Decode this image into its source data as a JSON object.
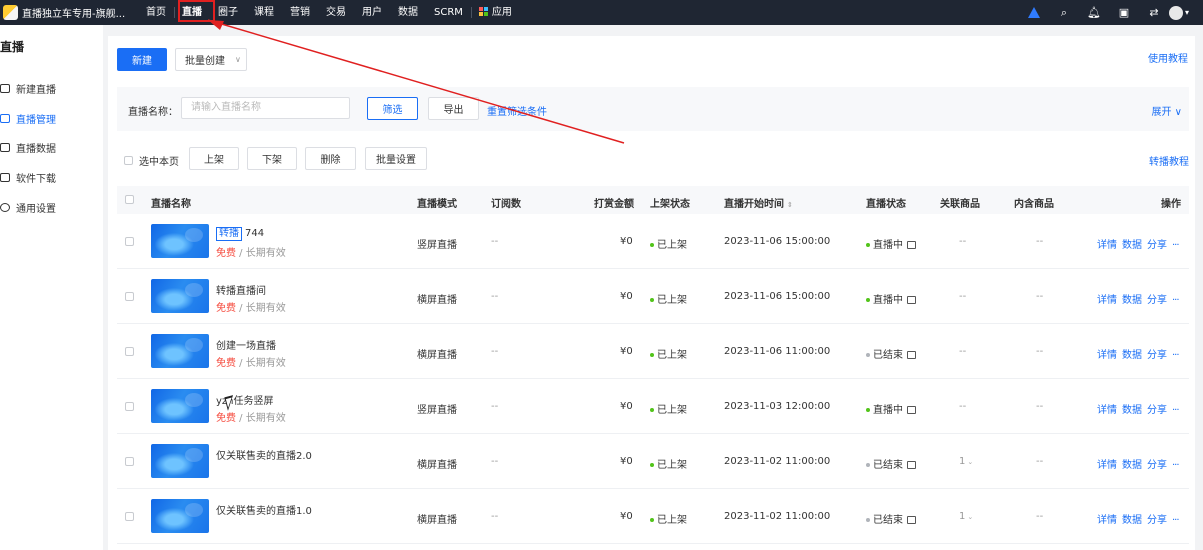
{
  "topbar": {
    "app_title": "直播独立车专用-旗舰...",
    "nav": [
      "首页",
      "直播",
      "圈子",
      "课程",
      "营销",
      "交易",
      "用户",
      "数据",
      "SCRM",
      "应用"
    ],
    "active_index": 1
  },
  "sidebar": {
    "title": "直播",
    "items": [
      "新建直播",
      "直播管理",
      "直播数据",
      "软件下载",
      "通用设置"
    ],
    "active_index": 1
  },
  "toolbar": {
    "new_label": "新建",
    "batch_create_label": "批量创建",
    "help_label": "使用教程"
  },
  "filter": {
    "label": "直播名称：",
    "placeholder": "请输入直播名称",
    "filter_label": "筛选",
    "export_label": "导出",
    "reset_label": "重置筛选条件",
    "expand_label": "展开"
  },
  "bulk": {
    "select_page_label": "选中本页",
    "buttons": [
      "上架",
      "下架",
      "删除",
      "批量设置"
    ],
    "rebroadcast_label": "转播教程"
  },
  "table": {
    "headers": [
      "直播名称",
      "直播模式",
      "订阅数",
      "打赏金额",
      "上架状态",
      "直播开始时间",
      "直播状态",
      "关联商品",
      "内含商品",
      "操作"
    ],
    "rows": [
      {
        "tag": "转播",
        "name": "744",
        "free": "免费",
        "validity": " / 长期有效",
        "mode": "竖屏直播",
        "subs": "--",
        "amount": "¥0",
        "listing": "已上架",
        "start": "2023-11-06 15:00:00",
        "status": "直播中",
        "linked": "--",
        "contains": "--",
        "ops": [
          "详情",
          "数据",
          "分享"
        ]
      },
      {
        "tag": "",
        "name": "转播直播间",
        "free": "免费",
        "validity": " / 长期有效",
        "mode": "横屏直播",
        "subs": "--",
        "amount": "¥0",
        "listing": "已上架",
        "start": "2023-11-06 15:00:00",
        "status": "直播中",
        "linked": "--",
        "contains": "--",
        "ops": [
          "详情",
          "数据",
          "分享"
        ]
      },
      {
        "tag": "",
        "name": "创建一场直播",
        "free": "免费",
        "validity": " / 长期有效",
        "mode": "横屏直播",
        "subs": "--",
        "amount": "¥0",
        "listing": "已上架",
        "start": "2023-11-06 11:00:00",
        "status": "已结束",
        "linked": "--",
        "contains": "--",
        "ops": [
          "详情",
          "数据",
          "分享"
        ]
      },
      {
        "tag": "",
        "name": "yzh任务竖屏",
        "free": "免费",
        "validity": " / 长期有效",
        "mode": "竖屏直播",
        "subs": "--",
        "amount": "¥0",
        "listing": "已上架",
        "start": "2023-11-03 12:00:00",
        "status": "直播中",
        "linked": "--",
        "contains": "--",
        "ops": [
          "详情",
          "数据",
          "分享"
        ]
      },
      {
        "tag": "",
        "name": "仅关联售卖的直播2.0",
        "free": "",
        "validity": "",
        "mode": "横屏直播",
        "subs": "--",
        "amount": "¥0",
        "listing": "已上架",
        "start": "2023-11-02 11:00:00",
        "status": "已结束",
        "linked": "1",
        "contains": "--",
        "ops": [
          "详情",
          "数据",
          "分享"
        ]
      },
      {
        "tag": "",
        "name": "仅关联售卖的直播1.0",
        "free": "",
        "validity": "",
        "mode": "横屏直播",
        "subs": "--",
        "amount": "¥0",
        "listing": "已上架",
        "start": "2023-11-02 11:00:00",
        "status": "已结束",
        "linked": "1",
        "contains": "--",
        "ops": [
          "详情",
          "数据",
          "分享"
        ]
      }
    ]
  },
  "colors": {
    "primary": "#1a6ef5",
    "topbar_bg": "#1f2633",
    "live_dot": "#52c41a",
    "ended_dot": "#b0b4ba",
    "free_text": "#f5483b",
    "annotation": "#e02020"
  }
}
